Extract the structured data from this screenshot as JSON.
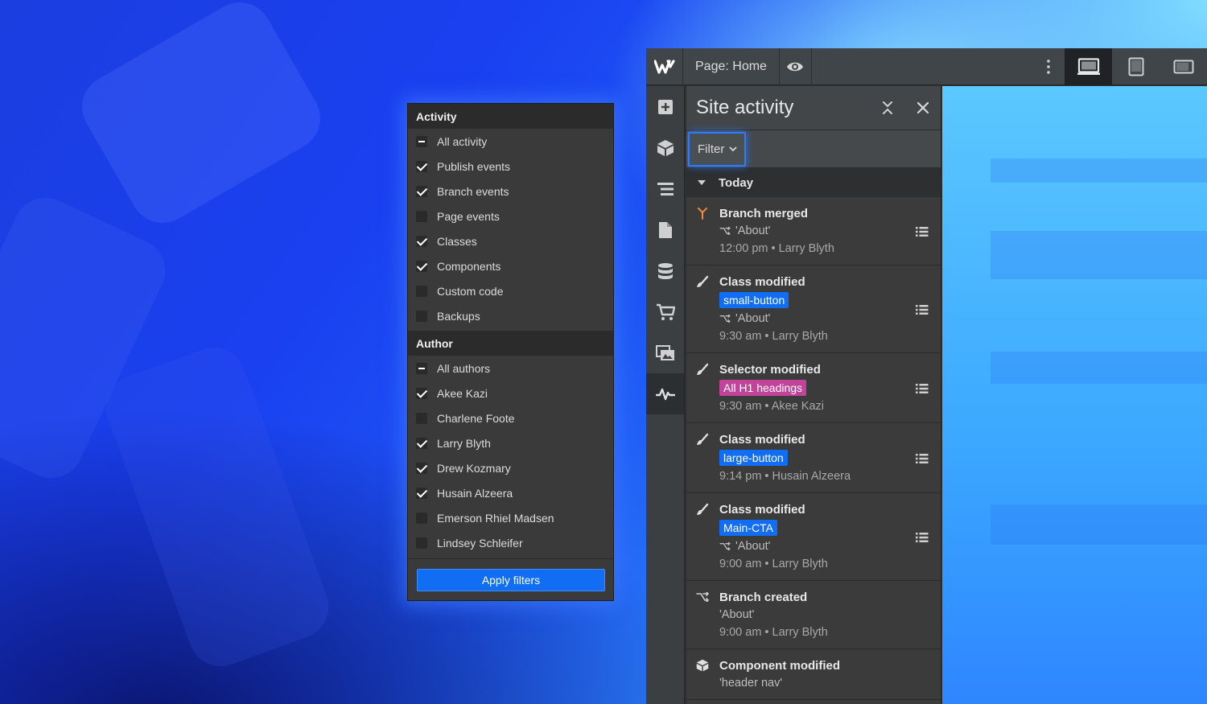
{
  "filter_panel": {
    "activity_header": "Activity",
    "activity_items": [
      {
        "label": "All activity",
        "state": "mixed"
      },
      {
        "label": "Publish events",
        "state": "checked"
      },
      {
        "label": "Branch events",
        "state": "checked"
      },
      {
        "label": "Page events",
        "state": "unchecked"
      },
      {
        "label": "Classes",
        "state": "checked"
      },
      {
        "label": "Components",
        "state": "checked"
      },
      {
        "label": "Custom code",
        "state": "unchecked"
      },
      {
        "label": "Backups",
        "state": "unchecked"
      }
    ],
    "author_header": "Author",
    "author_items": [
      {
        "label": "All authors",
        "state": "mixed"
      },
      {
        "label": "Akee Kazi",
        "state": "checked"
      },
      {
        "label": "Charlene Foote",
        "state": "unchecked"
      },
      {
        "label": "Larry Blyth",
        "state": "checked"
      },
      {
        "label": "Drew Kozmary",
        "state": "checked"
      },
      {
        "label": "Husain Alzeera",
        "state": "checked"
      },
      {
        "label": "Emerson Rhiel Madsen",
        "state": "unchecked"
      },
      {
        "label": "Lindsey Schleifer",
        "state": "unchecked"
      }
    ],
    "apply_label": "Apply filters"
  },
  "topbar": {
    "logo": "W",
    "page_label": "Page: Home",
    "icons": [
      "webflow-logo-icon",
      "eye-icon",
      "more-vertical-icon",
      "desktop-icon",
      "tablet-icon",
      "mobile-landscape-icon"
    ]
  },
  "rail": {
    "icons": [
      "add-icon",
      "components-icon",
      "navigator-icon",
      "pages-icon",
      "cms-icon",
      "ecommerce-icon",
      "assets-icon",
      "activity-icon"
    ]
  },
  "activity_panel": {
    "title": "Site activity",
    "filter_label": "Filter",
    "group_label": "Today",
    "items": [
      {
        "icon": "merge-icon",
        "title": "Branch merged",
        "branch": "'About'",
        "meta": "12:00 pm • Larry Blyth"
      },
      {
        "icon": "brush-icon",
        "title": "Class modified",
        "tag": "small-button",
        "tag_color": "#116df4",
        "branch": "'About'",
        "meta": "9:30 am • Larry Blyth"
      },
      {
        "icon": "brush-icon",
        "title": "Selector modified",
        "tag": "All H1 headings",
        "tag_color": "#c2439a",
        "meta": "9:30 am • Akee Kazi"
      },
      {
        "icon": "brush-icon",
        "title": "Class modified",
        "tag": "large-button",
        "tag_color": "#116df4",
        "meta": "9:14 pm • Husain Alzeera"
      },
      {
        "icon": "brush-icon",
        "title": "Class modified",
        "tag": "Main-CTA",
        "tag_color": "#116df4",
        "branch": "'About'",
        "meta": "9:00 am • Larry Blyth"
      },
      {
        "icon": "branch-icon",
        "title": "Branch created",
        "plain": "'About'",
        "meta": "9:00 am • Larry Blyth"
      },
      {
        "icon": "component-icon",
        "title": "Component modified",
        "plain": "'header nav'"
      }
    ]
  },
  "colors": {
    "accent": "#116df4",
    "tag_blue": "#116df4",
    "tag_pink": "#c2439a",
    "panel_bg": "#3b3b3b",
    "merge_orange": "#f08a3c"
  }
}
